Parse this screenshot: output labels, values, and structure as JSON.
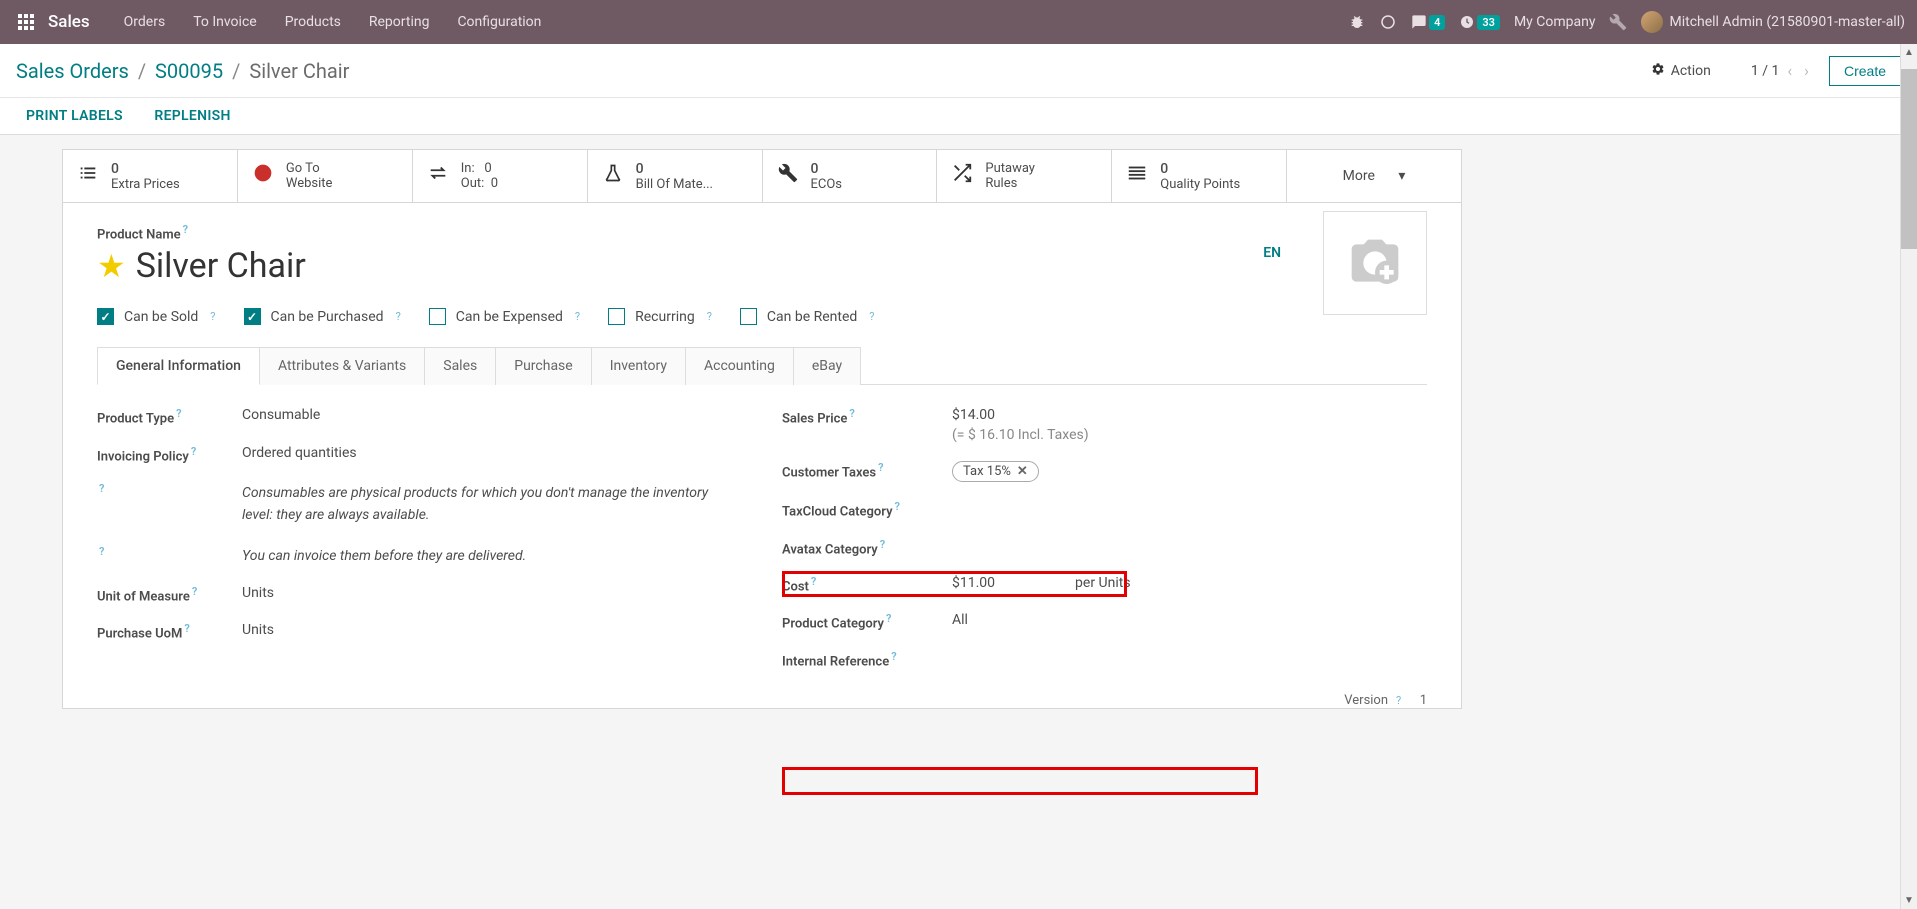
{
  "nav": {
    "brand": "Sales",
    "menu": [
      "Orders",
      "To Invoice",
      "Products",
      "Reporting",
      "Configuration"
    ],
    "discuss_badge": "4",
    "clock_badge": "33",
    "company": "My Company",
    "user": "Mitchell Admin (21580901-master-all)"
  },
  "breadcrumb": {
    "root": "Sales Orders",
    "mid": "S00095",
    "leaf": "Silver Chair"
  },
  "subbar": {
    "action_label": "Action",
    "pager": "1 / 1",
    "create": "Create"
  },
  "actionbar": {
    "print_labels": "PRINT LABELS",
    "replenish": "REPLENISH"
  },
  "stats": {
    "extra_prices": {
      "num": "0",
      "label": "Extra Prices"
    },
    "website": {
      "line1": "Go To",
      "line2": "Website"
    },
    "inout": {
      "in_label": "In:",
      "in_val": "0",
      "out_label": "Out:",
      "out_val": "0"
    },
    "bom": {
      "num": "0",
      "label": "Bill Of Mate..."
    },
    "ecos": {
      "num": "0",
      "label": "ECOs"
    },
    "putaway": {
      "line1": "Putaway",
      "line2": "Rules"
    },
    "quality": {
      "num": "0",
      "label": "Quality Points"
    },
    "more": "More"
  },
  "form": {
    "product_name_label": "Product Name",
    "product_name": "Silver Chair",
    "lang": "EN",
    "checks": {
      "sold": {
        "label": "Can be Sold",
        "checked": true
      },
      "purchased": {
        "label": "Can be Purchased",
        "checked": true
      },
      "expensed": {
        "label": "Can be Expensed",
        "checked": false
      },
      "recurring": {
        "label": "Recurring",
        "checked": false
      },
      "rented": {
        "label": "Can be Rented",
        "checked": false
      }
    },
    "tabs": [
      "General Information",
      "Attributes & Variants",
      "Sales",
      "Purchase",
      "Inventory",
      "Accounting",
      "eBay"
    ],
    "left": {
      "product_type": {
        "label": "Product Type",
        "value": "Consumable"
      },
      "invoicing_policy": {
        "label": "Invoicing Policy",
        "value": "Ordered quantities"
      },
      "hint1": "Consumables are physical products for which you don't manage the inventory level: they are always available.",
      "hint2": "You can invoice them before they are delivered.",
      "uom": {
        "label": "Unit of Measure",
        "value": "Units"
      },
      "purchase_uom": {
        "label": "Purchase UoM",
        "value": "Units"
      }
    },
    "right": {
      "sales_price": {
        "label": "Sales Price",
        "value": "$14.00",
        "incl": "(= $ 16.10 Incl. Taxes)"
      },
      "customer_taxes": {
        "label": "Customer Taxes",
        "tag": "Tax 15%"
      },
      "taxcloud": {
        "label": "TaxCloud Category"
      },
      "avatax": {
        "label": "Avatax Category"
      },
      "cost": {
        "label": "Cost",
        "value": "$11.00",
        "per": "per Units"
      },
      "product_category": {
        "label": "Product Category",
        "value": "All"
      },
      "internal_ref": {
        "label": "Internal Reference"
      },
      "version": {
        "label": "Version",
        "value": "1"
      }
    }
  }
}
